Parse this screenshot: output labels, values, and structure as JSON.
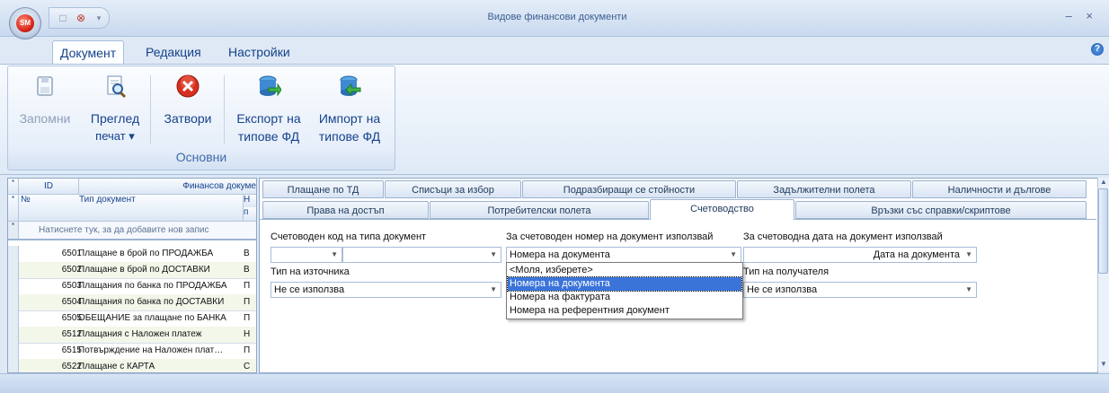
{
  "window": {
    "title": "Видове финансови документи",
    "app_logo": "SM",
    "controls": "– ×"
  },
  "ribbon_tabs": [
    {
      "label": "Документ",
      "active": true
    },
    {
      "label": "Редакция",
      "active": false
    },
    {
      "label": "Настройки",
      "active": false
    }
  ],
  "ribbon": {
    "group_label": "Основни",
    "buttons": [
      {
        "line1": "Запомни",
        "line2": "",
        "icon": "save-icon",
        "enabled": false
      },
      {
        "line1": "Преглед",
        "line2": "печат ▾",
        "icon": "print-preview-icon",
        "enabled": true
      },
      {
        "line1": "Затвори",
        "line2": "",
        "icon": "close-icon",
        "enabled": true
      },
      {
        "line1": "Експорт на",
        "line2": "типове ФД",
        "icon": "export-icon",
        "enabled": true
      },
      {
        "line1": "Импорт на",
        "line2": "типове ФД",
        "icon": "import-icon",
        "enabled": true
      }
    ]
  },
  "grid": {
    "header_id": "ID",
    "header_group": "Финансов докуме",
    "header_no": "№",
    "header_type": "Тип документ",
    "header_extra": "Н",
    "header_extra2": "п",
    "new_row_hint": "Натиснете тук, за да добавите нов запис",
    "rows": [
      {
        "id": "6501",
        "name": "Плащане в брой по ПРОДАЖБА",
        "extra": "В"
      },
      {
        "id": "6502",
        "name": "Плащане в брой по ДОСТАВКИ",
        "extra": "В"
      },
      {
        "id": "6503",
        "name": "Плащания по банка по ПРОДАЖБА",
        "extra": "П"
      },
      {
        "id": "6504",
        "name": "Плащания по банка по ДОСТАВКИ",
        "extra": "П"
      },
      {
        "id": "6505",
        "name": "ОБЕЩАНИЕ за плащане по БАНКА",
        "extra": "П"
      },
      {
        "id": "6512",
        "name": "Плащания с Наложен платеж",
        "extra": "Н"
      },
      {
        "id": "6515",
        "name": "Потвърждение на Наложен плат…",
        "extra": "П"
      },
      {
        "id": "6522",
        "name": "Плащане с КАРТА",
        "extra": "С"
      }
    ]
  },
  "tabs_row1": [
    "Плащане по ТД",
    "Списъци за избор",
    "Подразбиращи се стойности",
    "Задължителни полета",
    "Наличности и дългове"
  ],
  "tabs_row2": [
    "Права на достъп",
    "Потребителски полета",
    "Счетоводство",
    "Връзки със справки/скриптове"
  ],
  "active_tab": "Счетоводство",
  "form": {
    "acc_code_label": "Счетоводен код на типа документ",
    "acc_code_value1": "",
    "acc_code_value2": "",
    "acc_number_label": "За счетоводен номер на документ използвай",
    "acc_number_value": "Номера на документа",
    "acc_date_label": "За счетоводна дата на документ използвай",
    "acc_date_value": "Дата на документа",
    "source_label": "Тип на източника",
    "source_value": "Не се използва",
    "recipient_label": "Тип на получателя",
    "recipient_value": "Не се използва"
  },
  "dropdown_options": [
    {
      "label": "<Моля, изберете>",
      "selected": false
    },
    {
      "label": "Номера на документа",
      "selected": true
    },
    {
      "label": "Номера на фактурата",
      "selected": false
    },
    {
      "label": "Номера на референтния документ",
      "selected": false
    }
  ],
  "colors": {
    "accent": "#15428b",
    "selection": "#3b74d9",
    "alt_row": "#f2f7ea"
  }
}
